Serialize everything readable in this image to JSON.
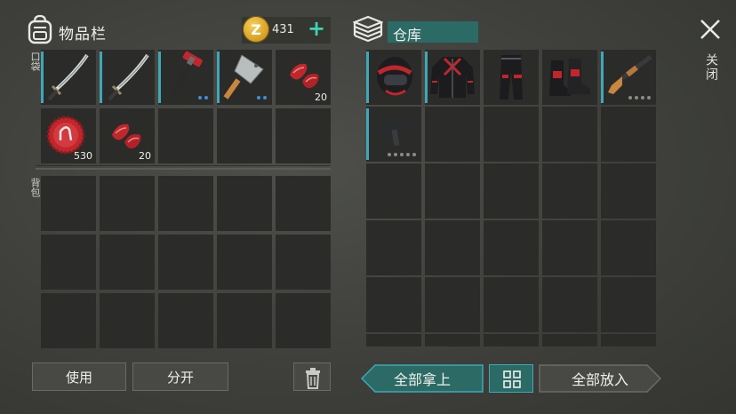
{
  "inventory": {
    "title": "物品栏",
    "coins": "431",
    "pocket_label": "口袋",
    "backpack_label": "背包",
    "pocket_slots": [
      {
        "item": "sword-icon",
        "count": "",
        "dots": 0
      },
      {
        "item": "sword-icon",
        "count": "",
        "dots": 0
      },
      {
        "item": "hammer-icon",
        "count": "",
        "dots": 2
      },
      {
        "item": "cleaver-icon",
        "count": "",
        "dots": 2
      },
      {
        "item": "raw-meat-icon",
        "count": "20",
        "dots": 0
      },
      {
        "item": "bottle-cap-icon",
        "count": "530",
        "dots": 0
      },
      {
        "item": "raw-meat-icon",
        "count": "20",
        "dots": 0
      }
    ]
  },
  "storage": {
    "title": "仓库",
    "slots": [
      {
        "item": "motorcycle-helmet-icon"
      },
      {
        "item": "biker-jacket-icon"
      },
      {
        "item": "biker-pants-icon"
      },
      {
        "item": "biker-boots-icon"
      },
      {
        "item": "shotgun-icon"
      },
      {
        "item": "smg-icon"
      }
    ]
  },
  "close_label": "关闭",
  "buttons": {
    "use": "使用",
    "split": "分开",
    "take_all": "全部拿上",
    "put_all": "全部放入"
  },
  "colors": {
    "accent_teal": "#3fd2b6",
    "slot_bar": "#3fa7b5",
    "storage_header": "#2c6a66",
    "coin_gold": "#e0a92a",
    "item_red": "#c0272d"
  }
}
